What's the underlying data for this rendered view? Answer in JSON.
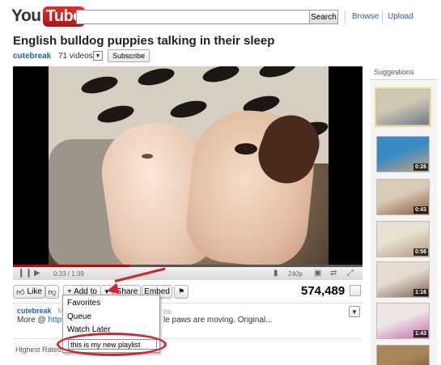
{
  "header": {
    "logo_you": "You",
    "logo_tube": "Tube",
    "search_value": "",
    "search_button": "Search",
    "links": [
      "Browse",
      "Upload"
    ]
  },
  "video": {
    "title": "English bulldog puppies talking in their sleep",
    "channel": "cutebreak",
    "video_count": "71 videos",
    "subscribe_label": "Subscribe",
    "time": "0:33 / 1:39",
    "progress": 0.333,
    "quality": "240p",
    "views": "574,489"
  },
  "actions": {
    "like": "Like",
    "add_to": "+ Add to",
    "share": "Share",
    "embed": "Embed"
  },
  "menu": {
    "items": [
      "Favorites",
      "Queue",
      "Watch Later"
    ],
    "new_playlist_value": "this is my new playlist"
  },
  "description": {
    "uploader": "cutebreak",
    "uploader_fragment": "M",
    "fragment_right": "os",
    "more_prefix": "More @ ",
    "link_fragment": "http://w",
    "text_tail": "le paws are moving. Original..."
  },
  "comments": {
    "header_fragment": "Highest Rated"
  },
  "sidebar": {
    "title": "Suggestions",
    "thumbs": [
      {
        "duration": "",
        "colors": [
          "#cfc9b3",
          "#6f7a8d"
        ]
      },
      {
        "duration": "0:26",
        "colors": [
          "#3a8ac4",
          "#c9a37e"
        ]
      },
      {
        "duration": "0:43",
        "colors": [
          "#d8cbb8",
          "#8b5a3a"
        ]
      },
      {
        "duration": "0:56",
        "colors": [
          "#e8e0d0",
          "#b29a80"
        ]
      },
      {
        "duration": "1:16",
        "colors": [
          "#e4dccf",
          "#7d6252"
        ]
      },
      {
        "duration": "1:43",
        "colors": [
          "#ece7e4",
          "#c86ab0"
        ]
      },
      {
        "duration": "",
        "colors": [
          "#a8865a",
          "#6c4c30"
        ]
      }
    ]
  },
  "colors": {
    "link": "#1c62b9",
    "annotation": "#d8232a",
    "progress": "#cc0000"
  }
}
